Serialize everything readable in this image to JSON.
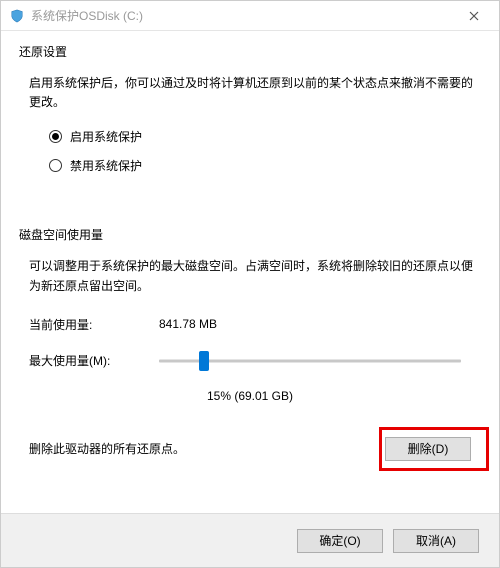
{
  "title": "系统保护OSDisk (C:)",
  "icons": {
    "titlebar": "shield",
    "close": "×"
  },
  "restore": {
    "section_title": "还原设置",
    "desc": "启用系统保护后，你可以通过及时将计算机还原到以前的某个状态点来撤消不需要的更改。",
    "options": {
      "enable": "启用系统保护",
      "disable": "禁用系统保护",
      "selected": "enable"
    }
  },
  "disk": {
    "section_title": "磁盘空间使用量",
    "desc": "可以调整用于系统保护的最大磁盘空间。占满空间时，系统将删除较旧的还原点以便为新还原点留出空间。",
    "current_label": "当前使用量:",
    "current_value": "841.78 MB",
    "max_label": "最大使用量(M):",
    "slider_percent": 15,
    "slider_caption": "15% (69.01 GB)",
    "delete_text": "删除此驱动器的所有还原点。",
    "delete_btn": "删除(D)"
  },
  "footer": {
    "ok": "确定(O)",
    "cancel": "取消(A)"
  }
}
